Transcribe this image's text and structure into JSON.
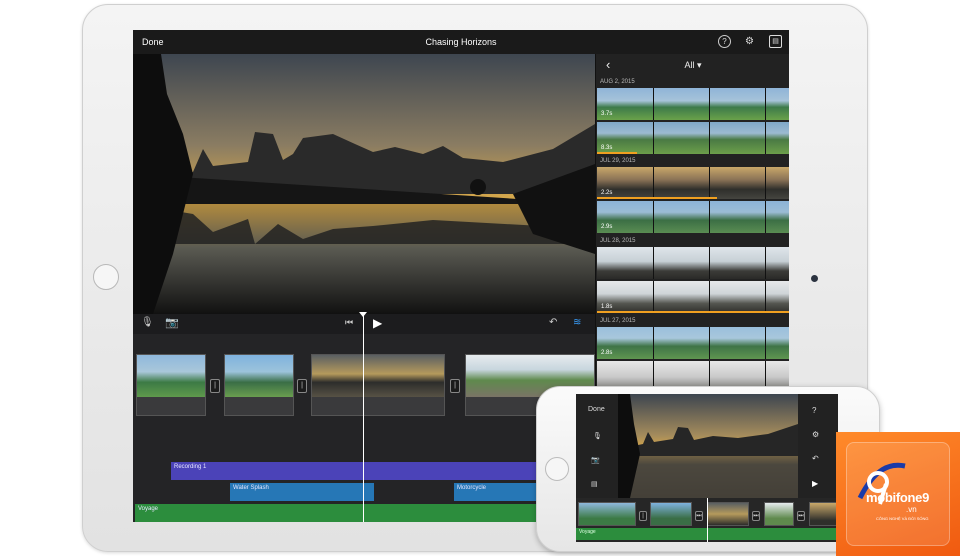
{
  "ipad": {
    "topbar": {
      "done_label": "Done",
      "project_title": "Chasing Horizons",
      "icons": [
        "help-icon",
        "settings-icon",
        "media-browser-icon"
      ]
    },
    "controls": {
      "icons": [
        "microphone-icon",
        "camera-icon",
        "skip-to-start-icon",
        "play-icon",
        "undo-icon",
        "audio-waveform-icon"
      ]
    },
    "browser": {
      "filter_label": "All",
      "sections": [
        {
          "date": "AUG 2, 2015",
          "clips": [
            {
              "duration": "3.7s"
            },
            {
              "duration": "8.3s"
            }
          ]
        },
        {
          "date": "JUL 29, 2015",
          "clips": [
            {
              "duration": "2.2s"
            },
            {
              "duration": "2.9s"
            }
          ]
        },
        {
          "date": "JUL 28, 2015",
          "clips": [
            {
              "duration": ""
            },
            {
              "duration": "1.8s"
            }
          ]
        },
        {
          "date": "JUL 27, 2015",
          "clips": [
            {
              "duration": "2.8s"
            },
            {
              "duration": ""
            }
          ]
        }
      ]
    },
    "timeline": {
      "audio_tracks": [
        {
          "label": "Recording 1",
          "type": "recording"
        },
        {
          "label": "Water Splash",
          "type": "sound-effect"
        },
        {
          "label": "Motorcycle",
          "type": "sound-effect"
        },
        {
          "label": "Voyage",
          "type": "music"
        }
      ]
    }
  },
  "iphone": {
    "done_label": "Done",
    "music_track_label": "Voyage"
  },
  "watermark": {
    "brand": "mobifone9",
    "domain": ".vn",
    "tagline": "CÔNG NGHỆ VÀ ĐỜI SỐNG"
  },
  "colors": {
    "recording_track": "#4b43b8",
    "sfx_track": "#2677b6",
    "music_track": "#2c8d3d",
    "watermark": "#f05a10"
  }
}
